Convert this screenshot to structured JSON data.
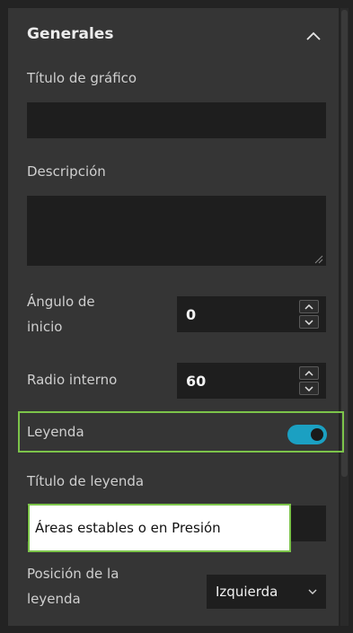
{
  "section": {
    "title": "Generales"
  },
  "fields": {
    "chart_title_label": "Título de gráfico",
    "chart_title_value": "",
    "description_label": "Descripción",
    "description_value": "",
    "start_angle_label_line1": "Ángulo de",
    "start_angle_label_line2": "inicio",
    "start_angle_value": "0",
    "inner_radius_label": "Radio interno",
    "inner_radius_value": "60",
    "legend_label": "Leyenda",
    "legend_enabled": true,
    "legend_title_label": "Título de leyenda",
    "legend_title_value": "Áreas estables o en Presión",
    "legend_position_label_line1": "Posición de la",
    "legend_position_label_line2": "leyenda",
    "legend_position_value": "Izquierda"
  },
  "colors": {
    "toggle_on": "#1ba0c2",
    "highlight": "#7cc44a"
  }
}
